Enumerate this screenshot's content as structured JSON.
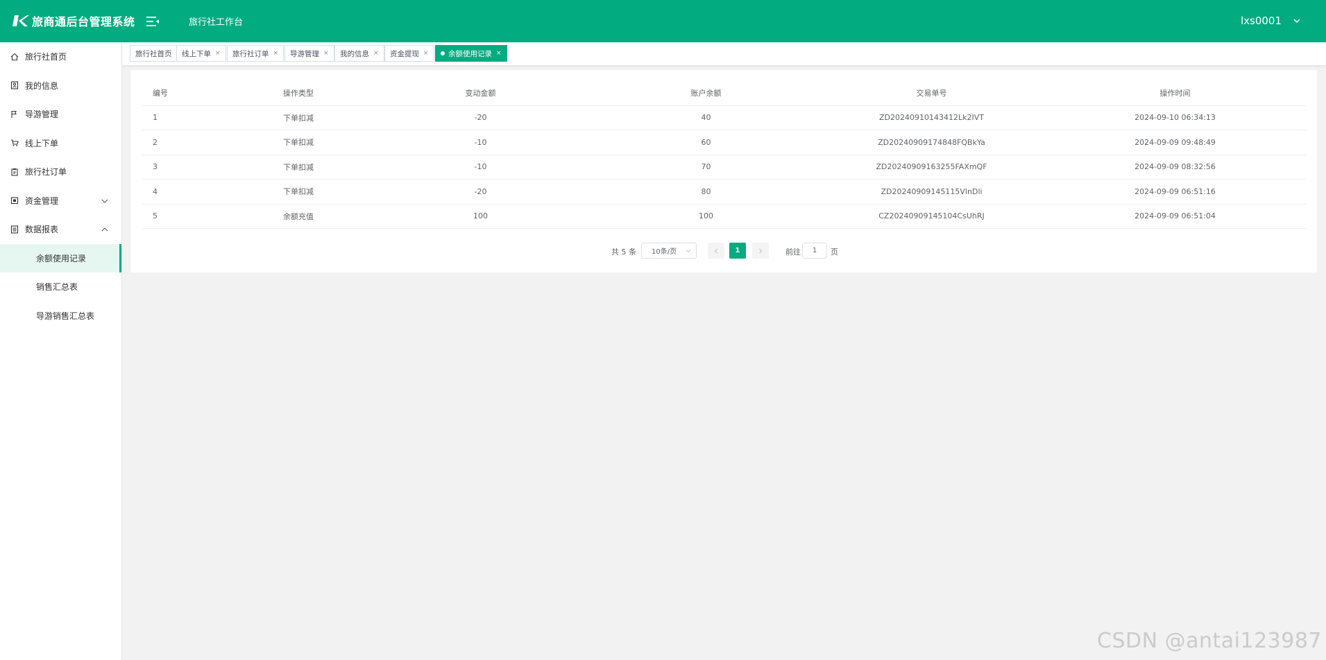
{
  "header": {
    "app_title": "旅商通后台管理系统",
    "workbench": "旅行社工作台",
    "username": "lxs0001"
  },
  "sidebar": {
    "items": [
      {
        "label": "旅行社首页",
        "icon": "home-icon"
      },
      {
        "label": "我的信息",
        "icon": "profile-icon"
      },
      {
        "label": "导游管理",
        "icon": "flag-icon"
      },
      {
        "label": "线上下单",
        "icon": "cart-icon"
      },
      {
        "label": "旅行社订单",
        "icon": "clipboard-icon"
      },
      {
        "label": "资金管理",
        "icon": "wallet-icon",
        "expanded": false
      },
      {
        "label": "数据报表",
        "icon": "report-icon",
        "expanded": true
      }
    ],
    "sub_items": [
      {
        "label": "余额使用记录",
        "active": true
      },
      {
        "label": "销售汇总表",
        "active": false
      },
      {
        "label": "导游销售汇总表",
        "active": false
      }
    ]
  },
  "tabs": [
    {
      "label": "旅行社首页",
      "closable": false
    },
    {
      "label": "线上下单",
      "closable": true
    },
    {
      "label": "旅行社订单",
      "closable": true
    },
    {
      "label": "导游管理",
      "closable": true
    },
    {
      "label": "我的信息",
      "closable": true
    },
    {
      "label": "资金提现",
      "closable": true
    },
    {
      "label": "余额使用记录",
      "closable": true,
      "active": true
    }
  ],
  "table": {
    "columns": [
      "编号",
      "操作类型",
      "变动金额",
      "账户余额",
      "交易单号",
      "操作时间"
    ],
    "rows": [
      [
        "1",
        "下单扣减",
        "-20",
        "40",
        "ZD20240910143412Lk2IVT",
        "2024-09-10 06:34:13"
      ],
      [
        "2",
        "下单扣减",
        "-10",
        "60",
        "ZD20240909174848FQBkYa",
        "2024-09-09 09:48:49"
      ],
      [
        "3",
        "下单扣减",
        "-10",
        "70",
        "ZD20240909163255FAXmQF",
        "2024-09-09 08:32:56"
      ],
      [
        "4",
        "下单扣减",
        "-20",
        "80",
        "ZD20240909145115VlnDli",
        "2024-09-09 06:51:16"
      ],
      [
        "5",
        "余额充值",
        "100",
        "100",
        "CZ20240909145104CsUhRJ",
        "2024-09-09 06:51:04"
      ]
    ]
  },
  "pagination": {
    "total": "共 5 条",
    "page_size": "10条/页",
    "current_page": "1",
    "goto_label": "前往",
    "goto_value": "1",
    "page_unit": "页"
  },
  "watermark": "CSDN @antai123987",
  "colors": {
    "accent": "#03ab80"
  }
}
